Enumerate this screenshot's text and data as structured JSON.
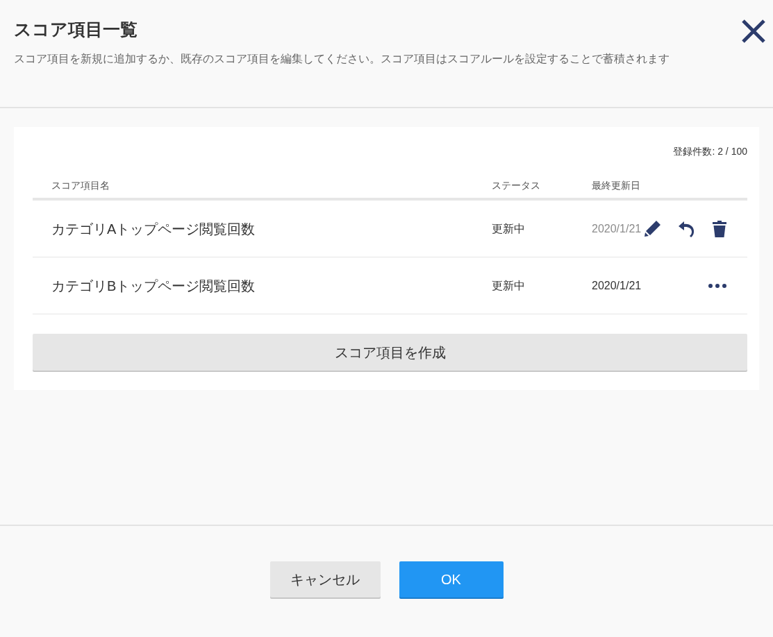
{
  "dialog": {
    "title": "スコア項目一覧",
    "description": "スコア項目を新規に追加するか、既存のスコア項目を編集してください。スコア項目はスコアルールを設定することで蓄積されます"
  },
  "list": {
    "count": "登録件数: 2 / 100",
    "columns": [
      "スコア項目名",
      "ステータス",
      "最終更新日"
    ],
    "rows": [
      {
        "name": "カテゴリAトップページ閲覧回数",
        "status": "更新中",
        "updated": "2020/1/21",
        "hovered": true
      },
      {
        "name": "カテゴリBトップページ閲覧回数",
        "status": "更新中",
        "updated": "2020/1/21",
        "hovered": false
      }
    ],
    "create_button": "スコア項目を作成"
  },
  "footer": {
    "buttons": [
      {
        "label": "キャンセル",
        "kind": "secondary"
      },
      {
        "label": "OK",
        "kind": "primary"
      }
    ]
  }
}
